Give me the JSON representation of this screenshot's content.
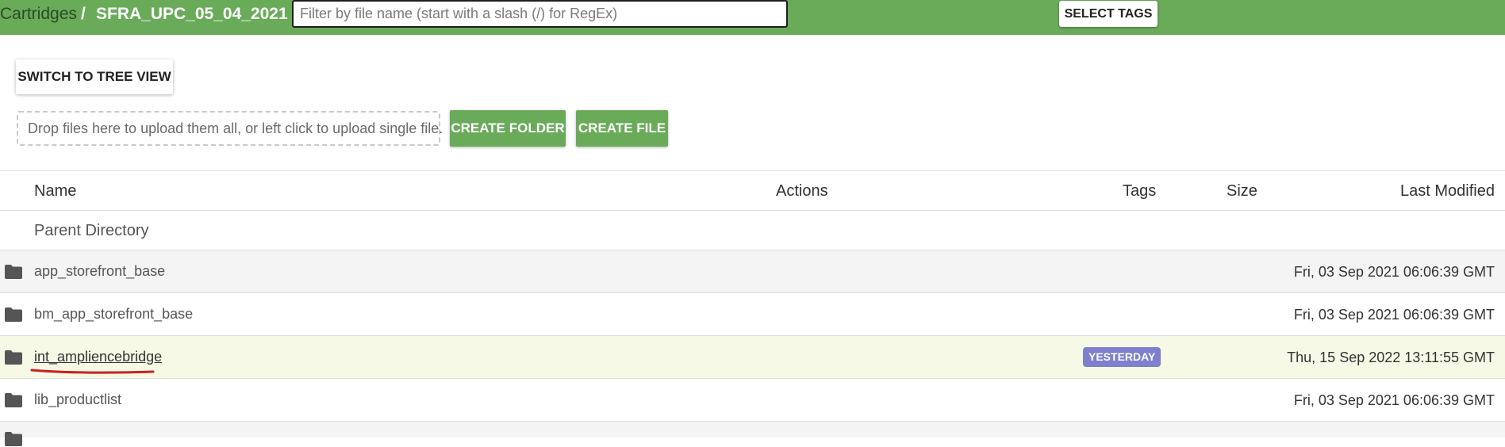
{
  "breadcrumb": {
    "root": "Cartridges",
    "separator": "/",
    "current": "SFRA_UPC_05_04_2021"
  },
  "filter": {
    "placeholder": "Filter by file name (start with a slash (/) for RegEx)",
    "value": ""
  },
  "toolbar": {
    "select_tags_label": "SELECT TAGS",
    "tree_view_label": "SWITCH TO TREE VIEW",
    "dropzone_text": "Drop files here to upload them all, or left click to upload single file.",
    "create_folder_label": "CREATE FOLDER",
    "create_file_label": "CREATE FILE"
  },
  "table": {
    "columns": {
      "name": "Name",
      "actions": "Actions",
      "tags": "Tags",
      "size": "Size",
      "last_modified": "Last Modified"
    },
    "parent_directory": "Parent Directory",
    "rows": [
      {
        "name": "app_storefront_base",
        "tag": "",
        "size": "",
        "modified": "Fri, 03 Sep 2021 06:06:39 GMT",
        "icon": "folder-icon"
      },
      {
        "name": "bm_app_storefront_base",
        "tag": "",
        "size": "",
        "modified": "Fri, 03 Sep 2021 06:06:39 GMT",
        "icon": "folder-icon"
      },
      {
        "name": "int_ampliencebridge",
        "tag": "YESTERDAY",
        "size": "",
        "modified": "Thu, 15 Sep 2022 13:11:55 GMT",
        "icon": "folder-icon"
      },
      {
        "name": "lib_productlist",
        "tag": "",
        "size": "",
        "modified": "Fri, 03 Sep 2021 06:06:39 GMT",
        "icon": "folder-icon"
      }
    ]
  },
  "colors": {
    "topbar": "#6aab5a",
    "primary_button": "#6aab5a",
    "tag_badge": "#7f7fcf",
    "highlight_row": "#f6f9e6",
    "alt_row": "#f4f4f4",
    "annotation": "#cc1f1f"
  }
}
